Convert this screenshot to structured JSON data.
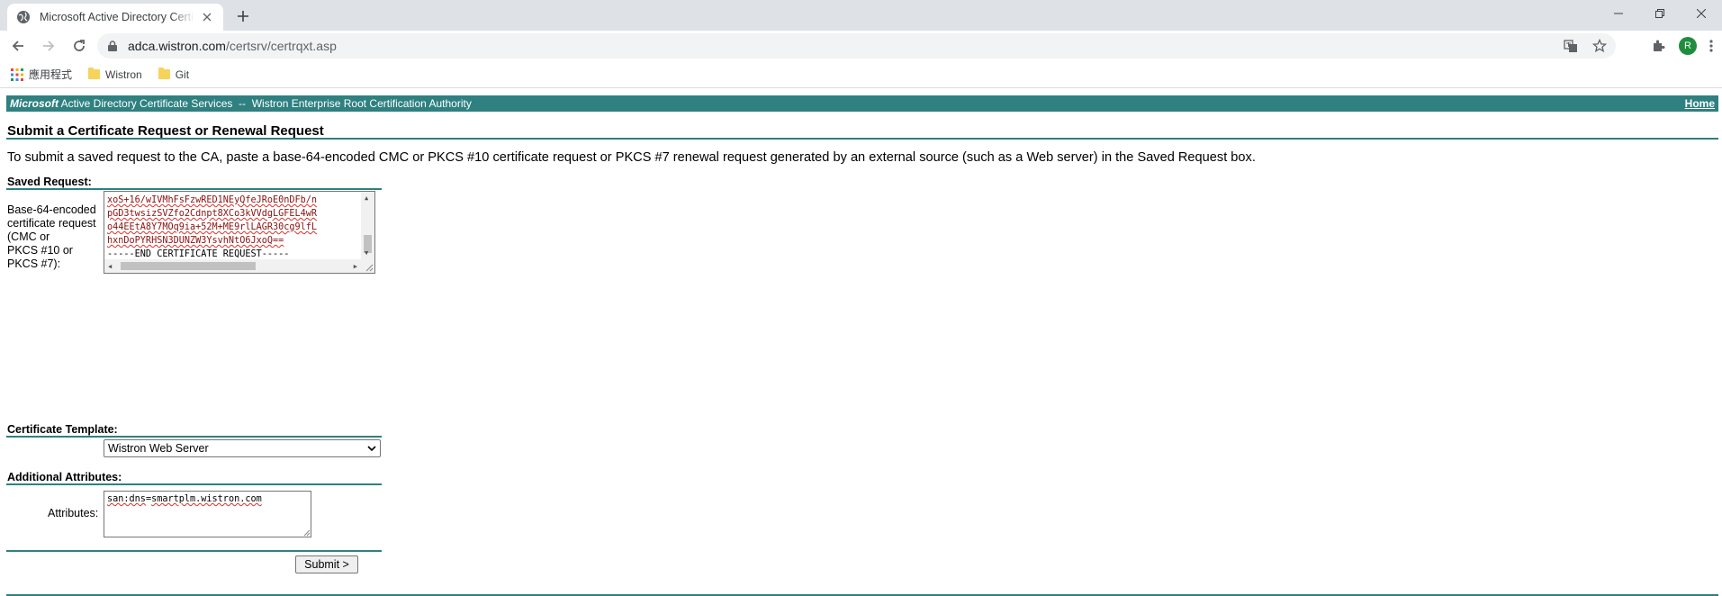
{
  "browser": {
    "tab_title": "Microsoft Active Directory Certificate Services",
    "url_host": "adca.wistron.com",
    "url_path": "/certsrv/certrqxt.asp",
    "profile_initial": "R",
    "bookmarks": [
      {
        "label": "應用程式",
        "icon": "apps-grid-icon"
      },
      {
        "label": "Wistron",
        "icon": "folder-icon"
      },
      {
        "label": "Git",
        "icon": "folder-icon"
      }
    ]
  },
  "banner": {
    "brand": "Microsoft",
    "service": " Active Directory Certificate Services  --  Wistron Enterprise Root Certification Authority",
    "home_link": "Home",
    "color": "#2f8080"
  },
  "page": {
    "title": "Submit a Certificate Request or Renewal Request",
    "intro": "To submit a saved request to the CA, paste a base-64-encoded CMC or PKCS #10 certificate request or PKCS #7 renewal request generated by an external source (such as a Web server) in the Saved Request box."
  },
  "saved_request": {
    "section_label": "Saved Request:",
    "field_label_lines": [
      "Base-64-encoded",
      "certificate request",
      "(CMC or",
      "PKCS #10 or",
      "PKCS #7):"
    ],
    "lines": [
      "xoS+16/wIVMhFsFzwRED1NEyQfeJRoE0nDFb/n",
      "pGD3twsizSVZfo2Cdnpt8XCo3kVVdgLGFEL4wR",
      "o44EEtA8Y7MOq9ia+52M+ME9rlLAGR30cg9lfL",
      "hxnDoPYRHSN3DUNZW3YsvhNtO6JxoQ==",
      "-----END CERTIFICATE REQUEST-----"
    ]
  },
  "template": {
    "section_label": "Certificate Template:",
    "selected": "Wistron Web Server"
  },
  "attributes": {
    "section_label": "Additional Attributes:",
    "field_label": "Attributes:",
    "value_key": "san:dns",
    "value_eq": "=",
    "value_host": "smartplm.wistron.com"
  },
  "submit_label": "Submit >"
}
